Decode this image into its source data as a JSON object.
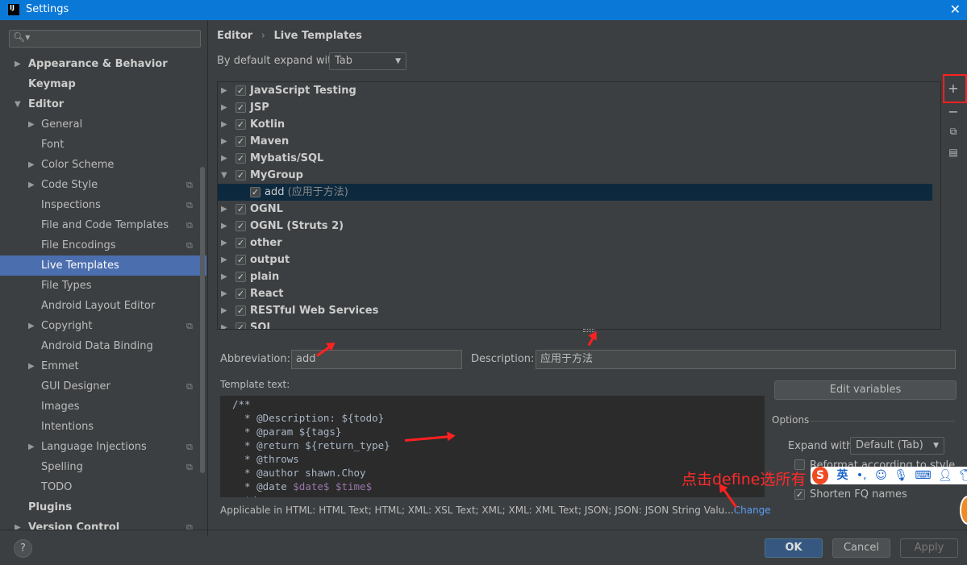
{
  "window": {
    "title": "Settings",
    "logo": "IJ",
    "close": "✕"
  },
  "sidebar": {
    "search_placeholder": "",
    "items": [
      {
        "label": "Appearance & Behavior",
        "level": 0,
        "arrow": "▶",
        "copy": false
      },
      {
        "label": "Keymap",
        "level": 0,
        "arrow": "",
        "copy": false
      },
      {
        "label": "Editor",
        "level": 0,
        "arrow": "▼",
        "copy": false
      },
      {
        "label": "General",
        "level": 1,
        "arrow": "▶",
        "copy": false
      },
      {
        "label": "Font",
        "level": 1,
        "arrow": "",
        "copy": false
      },
      {
        "label": "Color Scheme",
        "level": 1,
        "arrow": "▶",
        "copy": false
      },
      {
        "label": "Code Style",
        "level": 1,
        "arrow": "▶",
        "copy": true
      },
      {
        "label": "Inspections",
        "level": 1,
        "arrow": "",
        "copy": true
      },
      {
        "label": "File and Code Templates",
        "level": 1,
        "arrow": "",
        "copy": true
      },
      {
        "label": "File Encodings",
        "level": 1,
        "arrow": "",
        "copy": true
      },
      {
        "label": "Live Templates",
        "level": 1,
        "arrow": "",
        "copy": false,
        "selected": true
      },
      {
        "label": "File Types",
        "level": 1,
        "arrow": "",
        "copy": false
      },
      {
        "label": "Android Layout Editor",
        "level": 1,
        "arrow": "",
        "copy": false
      },
      {
        "label": "Copyright",
        "level": 1,
        "arrow": "▶",
        "copy": true
      },
      {
        "label": "Android Data Binding",
        "level": 1,
        "arrow": "",
        "copy": false
      },
      {
        "label": "Emmet",
        "level": 1,
        "arrow": "▶",
        "copy": false
      },
      {
        "label": "GUI Designer",
        "level": 1,
        "arrow": "",
        "copy": true
      },
      {
        "label": "Images",
        "level": 1,
        "arrow": "",
        "copy": false
      },
      {
        "label": "Intentions",
        "level": 1,
        "arrow": "",
        "copy": false
      },
      {
        "label": "Language Injections",
        "level": 1,
        "arrow": "▶",
        "copy": true
      },
      {
        "label": "Spelling",
        "level": 1,
        "arrow": "",
        "copy": true
      },
      {
        "label": "TODO",
        "level": 1,
        "arrow": "",
        "copy": false
      },
      {
        "label": "Plugins",
        "level": 0,
        "arrow": "",
        "copy": false
      },
      {
        "label": "Version Control",
        "level": 0,
        "arrow": "▶",
        "copy": true
      }
    ]
  },
  "main": {
    "breadcrumb": [
      "Editor",
      "Live Templates"
    ],
    "breadcrumb_sep": "›",
    "expand_label": "By default expand with",
    "expand_value": "Tab",
    "tree": [
      {
        "label": "JavaScript Testing",
        "arrow": "▶",
        "checked": true
      },
      {
        "label": "JSP",
        "arrow": "▶",
        "checked": true
      },
      {
        "label": "Kotlin",
        "arrow": "▶",
        "checked": true
      },
      {
        "label": "Maven",
        "arrow": "▶",
        "checked": true
      },
      {
        "label": "Mybatis/SQL",
        "arrow": "▶",
        "checked": true
      },
      {
        "label": "MyGroup",
        "arrow": "▼",
        "checked": true
      },
      {
        "label": "add",
        "desc": "(应用于方法)",
        "child": true,
        "checked": true,
        "selected": true
      },
      {
        "label": "OGNL",
        "arrow": "▶",
        "checked": true
      },
      {
        "label": "OGNL (Struts 2)",
        "arrow": "▶",
        "checked": true
      },
      {
        "label": "other",
        "arrow": "▶",
        "checked": true
      },
      {
        "label": "output",
        "arrow": "▶",
        "checked": true
      },
      {
        "label": "plain",
        "arrow": "▶",
        "checked": true
      },
      {
        "label": "React",
        "arrow": "▶",
        "checked": true
      },
      {
        "label": "RESTful Web Services",
        "arrow": "▶",
        "checked": true
      },
      {
        "label": "SQL",
        "arrow": "▶",
        "checked": true
      }
    ],
    "toolbar": {
      "add": "+",
      "remove": "−",
      "copy": "⧉",
      "restore": "▤"
    },
    "abbreviation_label": "Abbreviation:",
    "abbreviation_value": "add",
    "description_label": "Description:",
    "description_value": "应用于方法",
    "template_label": "Template text:",
    "template_lines": [
      "/**",
      "  * @Description: ${todo}",
      "  * @param ${tags}",
      "  * @return ${return_type}",
      "  * @throws",
      "  * @author shawn.Choy",
      "  * @date $date$ $time$",
      "  */"
    ],
    "applicable_text": "Applicable in HTML: HTML Text; HTML; XML: XSL Text; XML; XML: XML Text; JSON; JSON: JSON String Valu...",
    "change_link": "Change",
    "edit_variables": "Edit variables",
    "options_label": "Options",
    "expand_with_label": "Expand with",
    "expand_with_value": "Default (Tab)",
    "reformat_label": "Reformat according to style",
    "reformat_checked": false,
    "shorten_label": "Shorten FQ names",
    "shorten_checked": true
  },
  "footer": {
    "help": "?",
    "ok": "OK",
    "cancel": "Cancel",
    "apply": "Apply"
  },
  "annotation": {
    "text": "点击define选所有",
    "color": "#ff2020"
  },
  "ime": {
    "logo": "S",
    "lang": "英",
    "punct": "•,"
  }
}
